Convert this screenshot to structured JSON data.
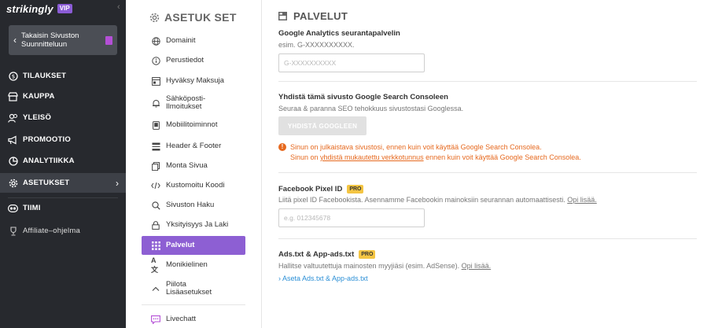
{
  "brand": {
    "name": "strikingly",
    "badge": "VIP"
  },
  "back_button": {
    "label": "Takaisin Sivuston Suunnitteluun"
  },
  "dark_nav": [
    {
      "label": "TILAUKSET",
      "icon": "dollar-icon"
    },
    {
      "label": "KAUPPA",
      "icon": "store-icon"
    },
    {
      "label": "YLEISÖ",
      "icon": "audience-icon"
    },
    {
      "label": "PROMOOTIO",
      "icon": "megaphone-icon"
    },
    {
      "label": "ANALYTIIKKA",
      "icon": "chart-icon"
    },
    {
      "label": "ASETUKSET",
      "icon": "gear-icon",
      "active": true
    },
    {
      "label": "TIIMI",
      "icon": "team-icon"
    },
    {
      "label": "Affiliate–ohjelma",
      "icon": "trophy-icon"
    }
  ],
  "settings": {
    "title": "ASETUK SET",
    "items": [
      {
        "label": "Domainit",
        "icon": "globe-icon"
      },
      {
        "label": "Perustiedot",
        "icon": "info-icon"
      },
      {
        "label": "Hyväksy Maksuja",
        "icon": "payment-icon"
      },
      {
        "label": "Sähköposti-Ilmoitukset",
        "icon": "bell-icon"
      },
      {
        "label": "Mobiilitoiminnot",
        "icon": "mobile-icon"
      },
      {
        "label": "Header & Footer",
        "icon": "header-footer-icon"
      },
      {
        "label": "Monta Sivua",
        "icon": "pages-icon"
      },
      {
        "label": "Kustomoitu Koodi",
        "icon": "code-icon"
      },
      {
        "label": "Sivuston Haku",
        "icon": "search-icon"
      },
      {
        "label": "Yksityisyys Ja Laki",
        "icon": "lock-icon"
      },
      {
        "label": "Palvelut",
        "icon": "grid-icon",
        "active": true
      },
      {
        "label": "Monikielinen",
        "icon": "translate-icon"
      },
      {
        "label": "Piilota Lisäasetukset",
        "icon": "chevron-up-icon"
      },
      {
        "label": "Livechatt",
        "icon": "chat-icon"
      }
    ]
  },
  "main": {
    "title": "PALVELUT",
    "ga": {
      "label": "Google Analytics seurantapalvelin",
      "hint": "esim. G-XXXXXXXXXX.",
      "placeholder": "G-XXXXXXXXXX"
    },
    "gsc": {
      "label": "Yhdistä tämä sivusto Google Search Consoleen",
      "hint": "Seuraa & paranna SEO tehokkuus sivustostasi Googlessa.",
      "button": "YHDISTÄ GOOGLEEN",
      "warn1": "Sinun on julkaistava sivustosi, ennen kuin voit käyttää Google Search Consolea.",
      "warn2_pre": "Sinun on ",
      "warn2_link": "yhdistä mukautettu verkkotunnus",
      "warn2_post": " ennen kuin voit käyttää Google Search Consolea."
    },
    "fb": {
      "label": "Facebook Pixel ID",
      "badge": "PRO",
      "hint": "Liitä pixel ID Facebookista. Asennamme Facebookin mainoksiin seurannan automaattisesti.",
      "link": "Opi lisää.",
      "placeholder": "e.g. 012345678"
    },
    "ads": {
      "label": "Ads.txt & App-ads.txt",
      "badge": "PRO",
      "hint": "Hallitse valtuutettuja mainosten myyjiäsi (esim. AdSense).",
      "link": "Opi lisää.",
      "action": "Aseta Ads.txt & App-ads.txt"
    }
  },
  "colors": {
    "accent": "#8d5fd3",
    "sidebar": "#27292e",
    "warning": "#e6691f",
    "link": "#2b8fd6",
    "pro": "#f4c543"
  }
}
